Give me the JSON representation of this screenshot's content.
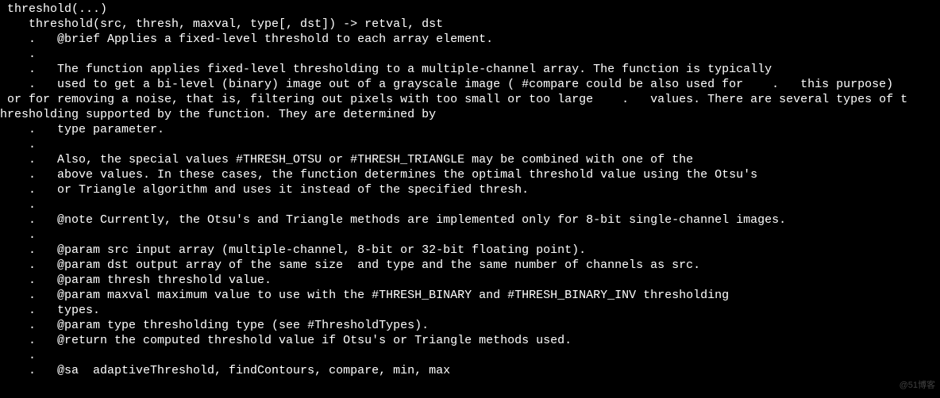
{
  "doc": {
    "lines": [
      " threshold(...)",
      "    threshold(src, thresh, maxval, type[, dst]) -> retval, dst",
      "    .   @brief Applies a fixed-level threshold to each array element.",
      "    .",
      "    .   The function applies fixed-level thresholding to a multiple-channel array. The function is typically",
      "    .   used to get a bi-level (binary) image out of a grayscale image ( #compare could be also used for    .   this purpose)",
      " or for removing a noise, that is, filtering out pixels with too small or too large    .   values. There are several types of t",
      "hresholding supported by the function. They are determined by",
      "    .   type parameter.",
      "    .",
      "    .   Also, the special values #THRESH_OTSU or #THRESH_TRIANGLE may be combined with one of the",
      "    .   above values. In these cases, the function determines the optimal threshold value using the Otsu's",
      "    .   or Triangle algorithm and uses it instead of the specified thresh.",
      "    .",
      "    .   @note Currently, the Otsu's and Triangle methods are implemented only for 8-bit single-channel images.",
      "    .",
      "    .   @param src input array (multiple-channel, 8-bit or 32-bit floating point).",
      "    .   @param dst output array of the same size  and type and the same number of channels as src.",
      "    .   @param thresh threshold value.",
      "    .   @param maxval maximum value to use with the #THRESH_BINARY and #THRESH_BINARY_INV thresholding",
      "    .   types.",
      "    .   @param type thresholding type (see #ThresholdTypes).",
      "    .   @return the computed threshold value if Otsu's or Triangle methods used.",
      "    .",
      "    .   @sa  adaptiveThreshold, findContours, compare, min, max",
      ""
    ]
  },
  "watermark": "@51博客"
}
